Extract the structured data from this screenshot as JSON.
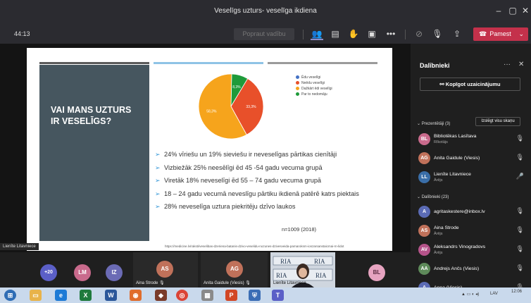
{
  "window": {
    "title": "Veselīgs uzturs- veselīga ikdiena"
  },
  "toolbar": {
    "timer": "44:13",
    "present_label": "Popraut vadību",
    "leave_label": "Pamest"
  },
  "slide": {
    "heading": "VAI MANS UZTURS IR VESELĪGS?",
    "chart_data": {
      "type": "pie",
      "slices": [
        {
          "label": "Ēdu veselīgi",
          "value": 0,
          "color": "#4472c4"
        },
        {
          "label": "Neēdu veselīgi",
          "value": 33.3,
          "value_label": "33,3%",
          "color": "#e8502a"
        },
        {
          "label": "Dažkārt ēdi veselīgi",
          "value": 58.3,
          "value_label": "58,3%",
          "color": "#f6a41c"
        },
        {
          "label": "Par to nedomāju",
          "value": 8.3,
          "value_label": "8,3%",
          "color": "#1f9a3a"
        }
      ]
    },
    "bullets": [
      "24% vīriešu un 19% sieviešu ir neveselīgas pārtikas cienītāji",
      "Vizbiežāk 25% neesēlīgi ēd 45 -54 gadu vecuma grupā",
      "Viretāk 18% neveselīgi ēd 55 – 74 gadu vecuma grupā",
      "18 – 24 gadu vecumā neveslīgu pārtiku ikdienā patērē katrs piektais",
      "28% neveselīga uztura piekritēju dzīvo laukos"
    ],
    "n_ref": "n=1009 (2018)",
    "source_url": "https://medicine.lv/raksti/veselibas-dzeriena-batanis-dzivo-veselidu-nozunes-dzivesveida-parnaroksm-ionzarsanstaicmai-rn-lidot"
  },
  "presenter_tag": "Lienīte Litavniece",
  "panel": {
    "title": "Dalībnieki",
    "copy_invite": "Kopīgot uzaicinājumu",
    "presenters_header": "Prezentētāji (3)",
    "mute_all": "Izslēgt visu skaņu",
    "attendees_header": "Dalībnieki (23)",
    "presenters": [
      {
        "initials": "BL",
        "name": "Bibliotēkas Lasītava",
        "role": "Rīkotājs",
        "color": "#c96a8c"
      },
      {
        "initials": "AG",
        "name": "Anita Gaidule (Viesis)",
        "role": "",
        "color": "#c0715a"
      },
      {
        "initials": "LL",
        "name": "Lienīte Litavniece",
        "role": "Ārējs",
        "color": "#3a6ea8"
      }
    ],
    "attendees": [
      {
        "initials": "A",
        "name": "agritaskestere@inbox.lv",
        "role": "",
        "color": "#5b6bb5"
      },
      {
        "initials": "AS",
        "name": "Aina Strode",
        "role": "Ārējs",
        "color": "#c0715a"
      },
      {
        "initials": "AV",
        "name": "Aleksandrs Vinogradovs",
        "role": "Ārējs",
        "color": "#b5538a"
      },
      {
        "initials": "AA",
        "name": "Andrejs Ančs (Viesis)",
        "role": "",
        "color": "#5e8a5a"
      },
      {
        "initials": "A",
        "name": "Anna (Viesis)",
        "role": "",
        "color": "#5b6bb5"
      }
    ]
  },
  "gallery": {
    "more_count": "+20",
    "tiles": [
      {
        "initials": "LM",
        "color": "#c96a8c"
      },
      {
        "initials": "IZ",
        "color": "#6b6bb5"
      },
      {
        "initials": "AS",
        "name": "Aina Strode",
        "color": "#c0715a"
      },
      {
        "initials": "AG",
        "name": "Anita Gaidule (Viesis)",
        "color": "#c0715a"
      },
      {
        "initials": "",
        "name": "Lienīte Litavniece",
        "color": "#3a6ea8"
      },
      {
        "initials": "BL",
        "color": "#c96a8c"
      }
    ]
  },
  "taskbar": {
    "language": "LAV",
    "time": "12:06"
  }
}
